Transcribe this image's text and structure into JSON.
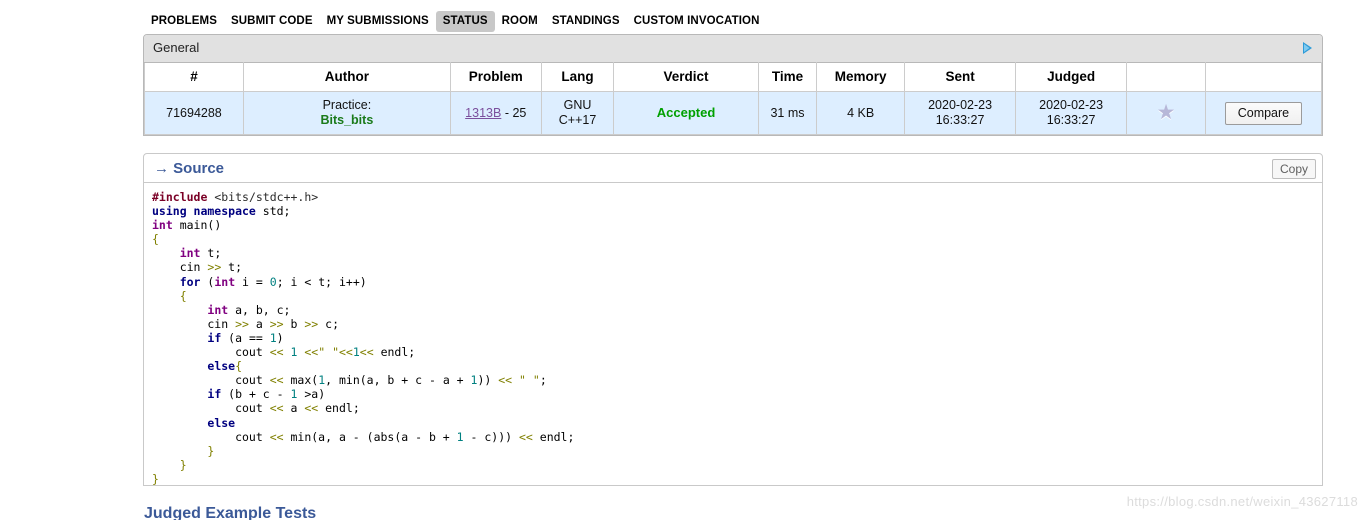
{
  "nav": {
    "items": [
      {
        "label": "PROBLEMS",
        "active": false
      },
      {
        "label": "SUBMIT CODE",
        "active": false
      },
      {
        "label": "MY SUBMISSIONS",
        "active": false
      },
      {
        "label": "STATUS",
        "active": true
      },
      {
        "label": "ROOM",
        "active": false
      },
      {
        "label": "STANDINGS",
        "active": false
      },
      {
        "label": "CUSTOM INVOCATION",
        "active": false
      }
    ]
  },
  "panel": {
    "caption": "General",
    "expand_icon": "triangle-right-icon",
    "table": {
      "headers": [
        "#",
        "Author",
        "Problem",
        "Lang",
        "Verdict",
        "Time",
        "Memory",
        "Sent",
        "Judged",
        "",
        ""
      ],
      "row": {
        "id": "71694288",
        "author_role": "Practice:",
        "author_name": "Bits_bits",
        "problem_link": "1313B",
        "problem_suffix": "- 25",
        "lang": "GNU\nC++17",
        "verdict": "Accepted",
        "time": "31 ms",
        "memory": "4 KB",
        "sent": "2020-02-23\n16:33:27",
        "judged": "2020-02-23\n16:33:27",
        "favorite_icon": "star-icon",
        "compare_label": "Compare"
      }
    }
  },
  "source": {
    "arrow": "→",
    "title": "Source",
    "copy_label": "Copy",
    "code_lines": [
      [
        {
          "t": "#include",
          "c": "k-pre"
        },
        {
          "t": " ",
          "c": ""
        },
        {
          "t": "<bits/stdc++.h>",
          "c": "k-hdr"
        }
      ],
      [
        {
          "t": "using namespace",
          "c": "k-kw"
        },
        {
          "t": " std;",
          "c": ""
        }
      ],
      [
        {
          "t": "int",
          "c": "k-type"
        },
        {
          "t": " main()",
          "c": ""
        }
      ],
      [
        {
          "t": "{",
          "c": "k-op"
        }
      ],
      [
        {
          "t": "    ",
          "c": ""
        },
        {
          "t": "int",
          "c": "k-type"
        },
        {
          "t": " t;",
          "c": ""
        }
      ],
      [
        {
          "t": "    cin ",
          "c": ""
        },
        {
          "t": ">>",
          "c": "k-op"
        },
        {
          "t": " t;",
          "c": ""
        }
      ],
      [
        {
          "t": "    ",
          "c": ""
        },
        {
          "t": "for",
          "c": "k-kw"
        },
        {
          "t": " (",
          "c": ""
        },
        {
          "t": "int",
          "c": "k-type"
        },
        {
          "t": " i = ",
          "c": ""
        },
        {
          "t": "0",
          "c": "k-num"
        },
        {
          "t": "; i < t; i++)",
          "c": ""
        }
      ],
      [
        {
          "t": "    ",
          "c": ""
        },
        {
          "t": "{",
          "c": "k-op"
        }
      ],
      [
        {
          "t": "        ",
          "c": ""
        },
        {
          "t": "int",
          "c": "k-type"
        },
        {
          "t": " a, b, c;",
          "c": ""
        }
      ],
      [
        {
          "t": "        cin ",
          "c": ""
        },
        {
          "t": ">>",
          "c": "k-op"
        },
        {
          "t": " a ",
          "c": ""
        },
        {
          "t": ">>",
          "c": "k-op"
        },
        {
          "t": " b ",
          "c": ""
        },
        {
          "t": ">>",
          "c": "k-op"
        },
        {
          "t": " c;",
          "c": ""
        }
      ],
      [
        {
          "t": "        ",
          "c": ""
        },
        {
          "t": "if",
          "c": "k-kw"
        },
        {
          "t": " (a == ",
          "c": ""
        },
        {
          "t": "1",
          "c": "k-num"
        },
        {
          "t": ")",
          "c": ""
        }
      ],
      [
        {
          "t": "            cout ",
          "c": ""
        },
        {
          "t": "<<",
          "c": "k-op"
        },
        {
          "t": " ",
          "c": ""
        },
        {
          "t": "1",
          "c": "k-num"
        },
        {
          "t": " ",
          "c": ""
        },
        {
          "t": "<<\" \"<<",
          "c": "k-op"
        },
        {
          "t": "1",
          "c": "k-num"
        },
        {
          "t": "<<",
          "c": "k-op"
        },
        {
          "t": " endl;",
          "c": ""
        }
      ],
      [
        {
          "t": "        ",
          "c": ""
        },
        {
          "t": "else",
          "c": "k-kw"
        },
        {
          "t": "{",
          "c": "k-op"
        }
      ],
      [
        {
          "t": "            cout ",
          "c": ""
        },
        {
          "t": "<<",
          "c": "k-op"
        },
        {
          "t": " max(",
          "c": ""
        },
        {
          "t": "1",
          "c": "k-num"
        },
        {
          "t": ", min(a, b + c - a + ",
          "c": ""
        },
        {
          "t": "1",
          "c": "k-num"
        },
        {
          "t": ")) ",
          "c": ""
        },
        {
          "t": "<<",
          "c": "k-op"
        },
        {
          "t": " ",
          "c": ""
        },
        {
          "t": "\" \"",
          "c": "k-op"
        },
        {
          "t": ";",
          "c": ""
        }
      ],
      [
        {
          "t": "        ",
          "c": ""
        },
        {
          "t": "if",
          "c": "k-kw"
        },
        {
          "t": " (b + c - ",
          "c": ""
        },
        {
          "t": "1",
          "c": "k-num"
        },
        {
          "t": " >a)",
          "c": ""
        }
      ],
      [
        {
          "t": "            cout ",
          "c": ""
        },
        {
          "t": "<<",
          "c": "k-op"
        },
        {
          "t": " a ",
          "c": ""
        },
        {
          "t": "<<",
          "c": "k-op"
        },
        {
          "t": " endl;",
          "c": ""
        }
      ],
      [
        {
          "t": "        ",
          "c": ""
        },
        {
          "t": "else",
          "c": "k-kw"
        }
      ],
      [
        {
          "t": "            cout ",
          "c": ""
        },
        {
          "t": "<<",
          "c": "k-op"
        },
        {
          "t": " min(a, a - (abs(a - b + ",
          "c": ""
        },
        {
          "t": "1",
          "c": "k-num"
        },
        {
          "t": " - c))) ",
          "c": ""
        },
        {
          "t": "<<",
          "c": "k-op"
        },
        {
          "t": " endl;",
          "c": ""
        }
      ],
      [
        {
          "t": "        ",
          "c": ""
        },
        {
          "t": "}",
          "c": "k-op"
        }
      ],
      [
        {
          "t": "    ",
          "c": ""
        },
        {
          "t": "}",
          "c": "k-op"
        }
      ],
      [
        {
          "t": "}",
          "c": "k-op"
        }
      ]
    ]
  },
  "bottom": {
    "heading": "Judged Example Tests"
  },
  "watermark": {
    "text": "https://blog.csdn.net/weixin_43627118"
  },
  "colors": {
    "nav_active_bg": "#c8c8c8",
    "panel_caption_bg": "#e1e1e1",
    "row_bg": "#ddeeff",
    "accepted_green": "#00a000",
    "author_green": "#1a7a1a",
    "link_purple": "#7b4f9d",
    "heading_blue": "#3b5998",
    "expand_blue": "#2e9bd8"
  }
}
